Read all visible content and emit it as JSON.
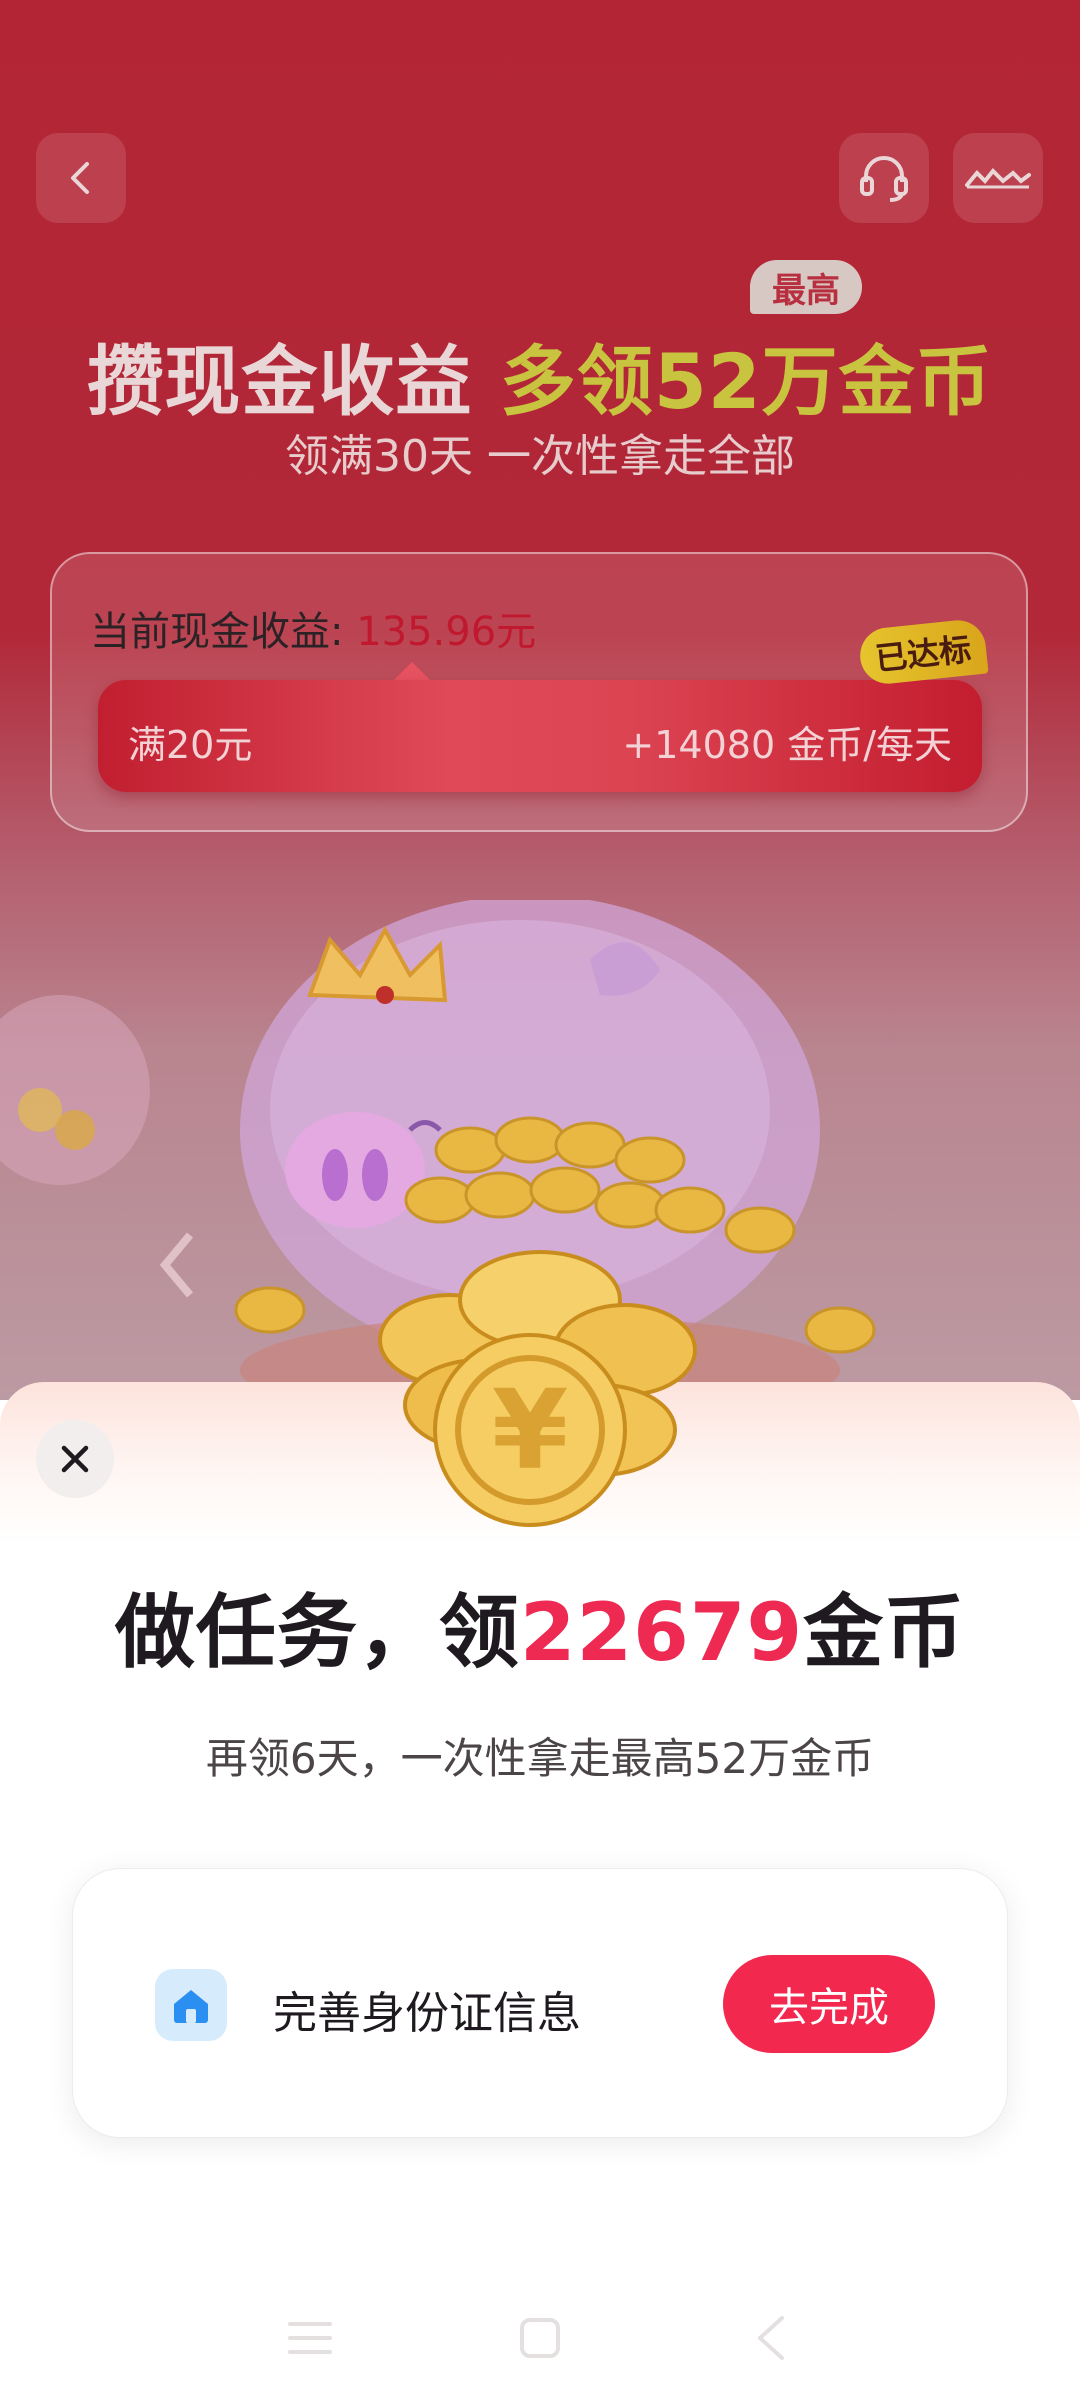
{
  "header": {
    "headline_part1": "攒现金收益",
    "headline_part2": "多领52万金币",
    "badge_max": "最高",
    "subtitle": "领满30天  一次性拿走全部"
  },
  "earnings": {
    "label": "当前现金收益: ",
    "value": "135.96元",
    "threshold": "满20元",
    "reward": "+14080 金币/每天",
    "reached_badge": "已达标"
  },
  "sheet": {
    "title_prefix": "做任务，领",
    "title_coins": "22679",
    "title_suffix": "金币",
    "subtitle": "再领6天，一次性拿走最高52万金币",
    "task": {
      "label": "完善身份证信息",
      "button": "去完成",
      "icon": "home-icon"
    }
  },
  "icons": {
    "back": "chevron-left-icon",
    "service": "headset-icon",
    "more": "more-icon",
    "close": "close-icon"
  },
  "colors": {
    "brand_red": "#b32535",
    "accent_pink": "#ee2a52",
    "headline_gold": "#c9c43f",
    "button": "#f2284f"
  }
}
